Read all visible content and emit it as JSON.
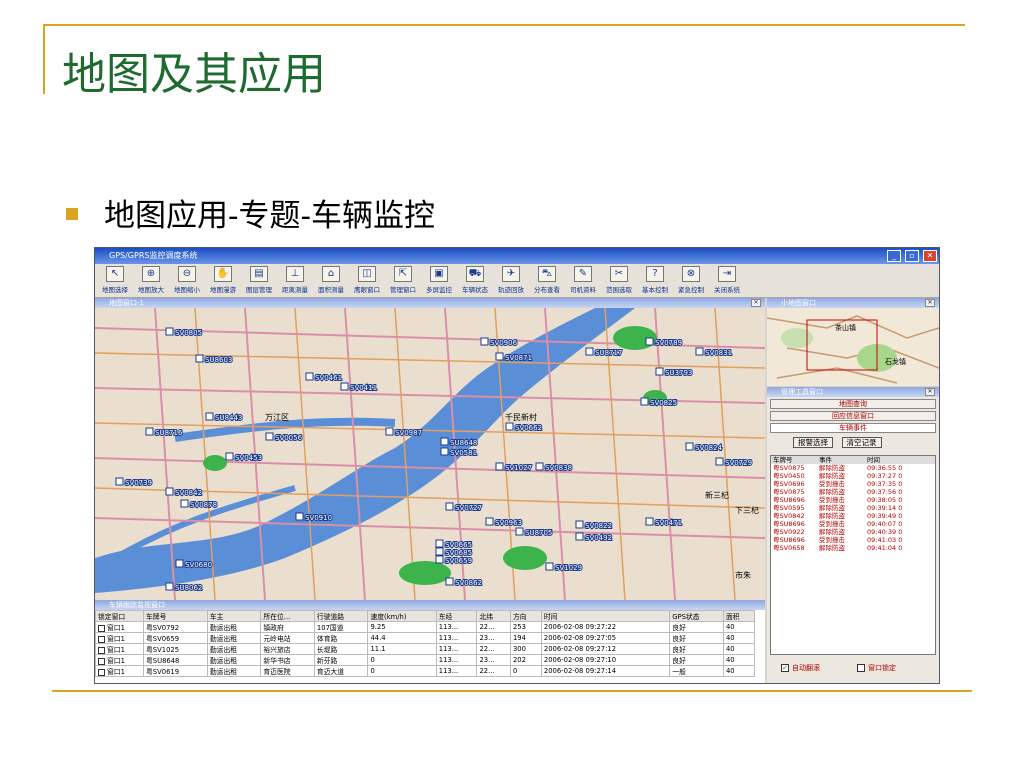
{
  "slide": {
    "title": "地图及其应用",
    "bullet": "地图应用-专题-车辆监控"
  },
  "app": {
    "window_title": "GPS/GPRS监控调度系统",
    "toolbar": [
      {
        "label": "地图选择",
        "icon": "pointer-icon",
        "glyph": "↖"
      },
      {
        "label": "地图放大",
        "icon": "zoom-in-icon",
        "glyph": "⊕"
      },
      {
        "label": "地图缩小",
        "icon": "zoom-out-icon",
        "glyph": "⊖"
      },
      {
        "label": "地图漫游",
        "icon": "hand-icon",
        "glyph": "✋"
      },
      {
        "label": "图层管理",
        "icon": "layers-icon",
        "glyph": "▤"
      },
      {
        "label": "距离测量",
        "icon": "ruler-icon",
        "glyph": "⊥"
      },
      {
        "label": "面积测量",
        "icon": "area-icon",
        "glyph": "⌂"
      },
      {
        "label": "鹰眼窗口",
        "icon": "eye-window-icon",
        "glyph": "◫"
      },
      {
        "label": "管理窗口",
        "icon": "manage-window-icon",
        "glyph": "⇱"
      },
      {
        "label": "多屏监控",
        "icon": "multi-screen-icon",
        "glyph": "▣"
      },
      {
        "label": "车辆状态",
        "icon": "vehicle-status-icon",
        "glyph": "⛟"
      },
      {
        "label": "轨迹回放",
        "icon": "track-replay-icon",
        "glyph": "✈"
      },
      {
        "label": "分布查看",
        "icon": "distribution-icon",
        "glyph": "⛍"
      },
      {
        "label": "司机资料",
        "icon": "driver-info-icon",
        "glyph": "✎"
      },
      {
        "label": "范围选取",
        "icon": "range-select-icon",
        "glyph": "✂"
      },
      {
        "label": "基本控制",
        "icon": "basic-control-icon",
        "glyph": "?"
      },
      {
        "label": "紧急控制",
        "icon": "emergency-control-icon",
        "glyph": "⊗"
      },
      {
        "label": "关闭系统",
        "icon": "close-system-icon",
        "glyph": "⇥"
      }
    ],
    "map_window_title": "地图窗口-1",
    "eagle_window_title": "小地图窗口",
    "toolwin_title": "管理工具窗口",
    "tool_buttons": [
      "地图查询",
      "回应信息窗口",
      "车辆事件"
    ],
    "alarm_select": "报警选择",
    "clear_records": "清空记录",
    "event_headers": [
      "车牌号",
      "事件",
      "时间"
    ],
    "events": [
      [
        "粤SV0875",
        "解除防盗",
        "09:36:55 0"
      ],
      [
        "粤SV0450",
        "解除防盗",
        "09:37:27 0"
      ],
      [
        "粤SV0696",
        "受到撞击",
        "09:37:35 0"
      ],
      [
        "粤SV0875",
        "解除防盗",
        "09:37:56 0"
      ],
      [
        "粤SU8696",
        "受到撞击",
        "09:38:05 0"
      ],
      [
        "粤SV0595",
        "解除防盗",
        "09:39:14 0"
      ],
      [
        "粤SV0842",
        "解除防盗",
        "09:39:49 0"
      ],
      [
        "粤SU8696",
        "受到撞击",
        "09:40:07 0"
      ],
      [
        "粤SV0922",
        "解除防盗",
        "09:40:39 0"
      ],
      [
        "粤SU8696",
        "受到撞击",
        "09:41:03 0"
      ],
      [
        "粤SV0658",
        "解除防盗",
        "09:41:04 0"
      ]
    ],
    "auto_scroll": "自动翻滚",
    "window_lock": "窗口锁定",
    "map_places": [
      "万江区",
      "千民新村",
      "新三杞",
      "下三杞",
      "市朱",
      "茶山镇",
      "石龙镇"
    ],
    "map_vehicles": [
      "SV0805",
      "SU8603",
      "SV0461",
      "SV0411",
      "SU8443",
      "SU8716",
      "SV0056",
      "SV0453",
      "SV0987",
      "SU8648",
      "SV0581",
      "SV0662",
      "SV0906",
      "SU8717",
      "SV0871",
      "SV0789",
      "SV0831",
      "SU3793",
      "SV0825",
      "SV1027",
      "SV0838",
      "SV0824",
      "SV0729",
      "SV0739",
      "SV0842",
      "SV0878",
      "SV0910",
      "SV0727",
      "SV0963",
      "SV0822",
      "SV0471",
      "SV0685",
      "SU8705",
      "SV0492",
      "SV0665",
      "SV0659",
      "SV0680",
      "SV1029",
      "SU8062",
      "SV0862"
    ],
    "monitor_title": "车辆跟踪监视窗口",
    "monitor_headers": [
      "锁定窗口",
      "车牌号",
      "车主",
      "所在位...",
      "行驶道路",
      "速度(km/h)",
      "东经",
      "北纬",
      "方向",
      "时间",
      "GPS状态",
      "面积"
    ],
    "monitor_rows": [
      [
        "窗口1",
        "粤SV0792",
        "勤运出租",
        "镇政府",
        "107国道",
        "9.25",
        "113...",
        "22...",
        "253",
        "2006-02-08 09:27:22",
        "良好",
        "40"
      ],
      [
        "窗口1",
        "粤SV0659",
        "勤运出租",
        "元岭电站",
        "体育路",
        "44.4",
        "113...",
        "23...",
        "194",
        "2006-02-08 09:27:05",
        "良好",
        "40"
      ],
      [
        "窗口1",
        "粤SV1025",
        "勤运出租",
        "裕兴旅店",
        "长堤路",
        "11.1",
        "113...",
        "22...",
        "300",
        "2006-02-08 09:27:12",
        "良好",
        "40"
      ],
      [
        "窗口1",
        "粤SU8648",
        "勤运出租",
        "新华书店",
        "新芬路",
        "0",
        "113...",
        "23...",
        "202",
        "2006-02-08 09:27:10",
        "良好",
        "40"
      ],
      [
        "窗口1",
        "粤SV0619",
        "勤运出租",
        "育迈医院",
        "育迈大道",
        "0",
        "113...",
        "22...",
        "0",
        "2006-02-08 09:27:14",
        "一般",
        "40"
      ]
    ]
  }
}
